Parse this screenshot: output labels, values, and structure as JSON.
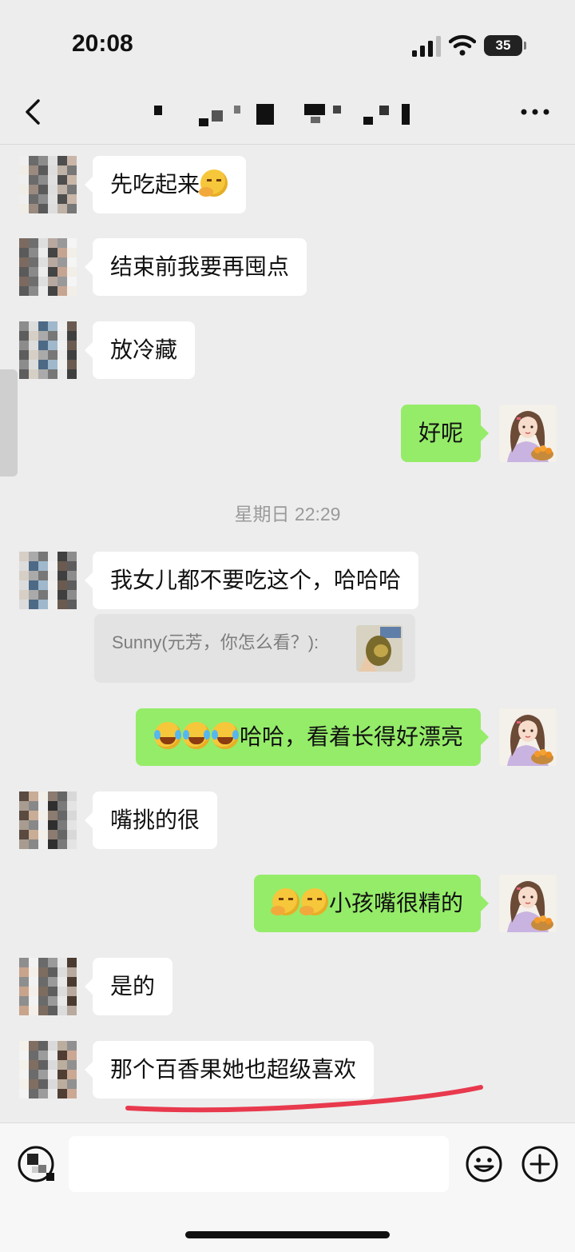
{
  "status_bar": {
    "time": "20:08",
    "battery": "35"
  },
  "nav": {
    "title_redacted": true
  },
  "messages": [
    {
      "side": "left",
      "text": "先吃起来",
      "emoji_after": [
        "think"
      ]
    },
    {
      "side": "left",
      "text": "结束前我要再囤点"
    },
    {
      "side": "left",
      "text": "放冷藏"
    },
    {
      "side": "right",
      "text": "好呢"
    },
    {
      "side": "left",
      "text": "我女儿都不要吃这个，哈哈哈"
    },
    {
      "side": "right",
      "text": "哈哈，看着长得好漂亮",
      "emoji_before": [
        "laugh",
        "laugh",
        "laugh"
      ]
    },
    {
      "side": "left",
      "text": "嘴挑的很"
    },
    {
      "side": "right",
      "text": "小孩嘴很精的",
      "emoji_before": [
        "think",
        "think"
      ]
    },
    {
      "side": "left",
      "text": "是的"
    },
    {
      "side": "left",
      "text": "那个百香果她也超级喜欢"
    }
  ],
  "timestamp": "星期日 22:29",
  "quote": {
    "text": "Sunny(元芳，你怎么看？):"
  },
  "colors": {
    "background": "#ededed",
    "self_bubble": "#95ec69",
    "other_bubble": "#ffffff",
    "underline": "#e8394d"
  }
}
